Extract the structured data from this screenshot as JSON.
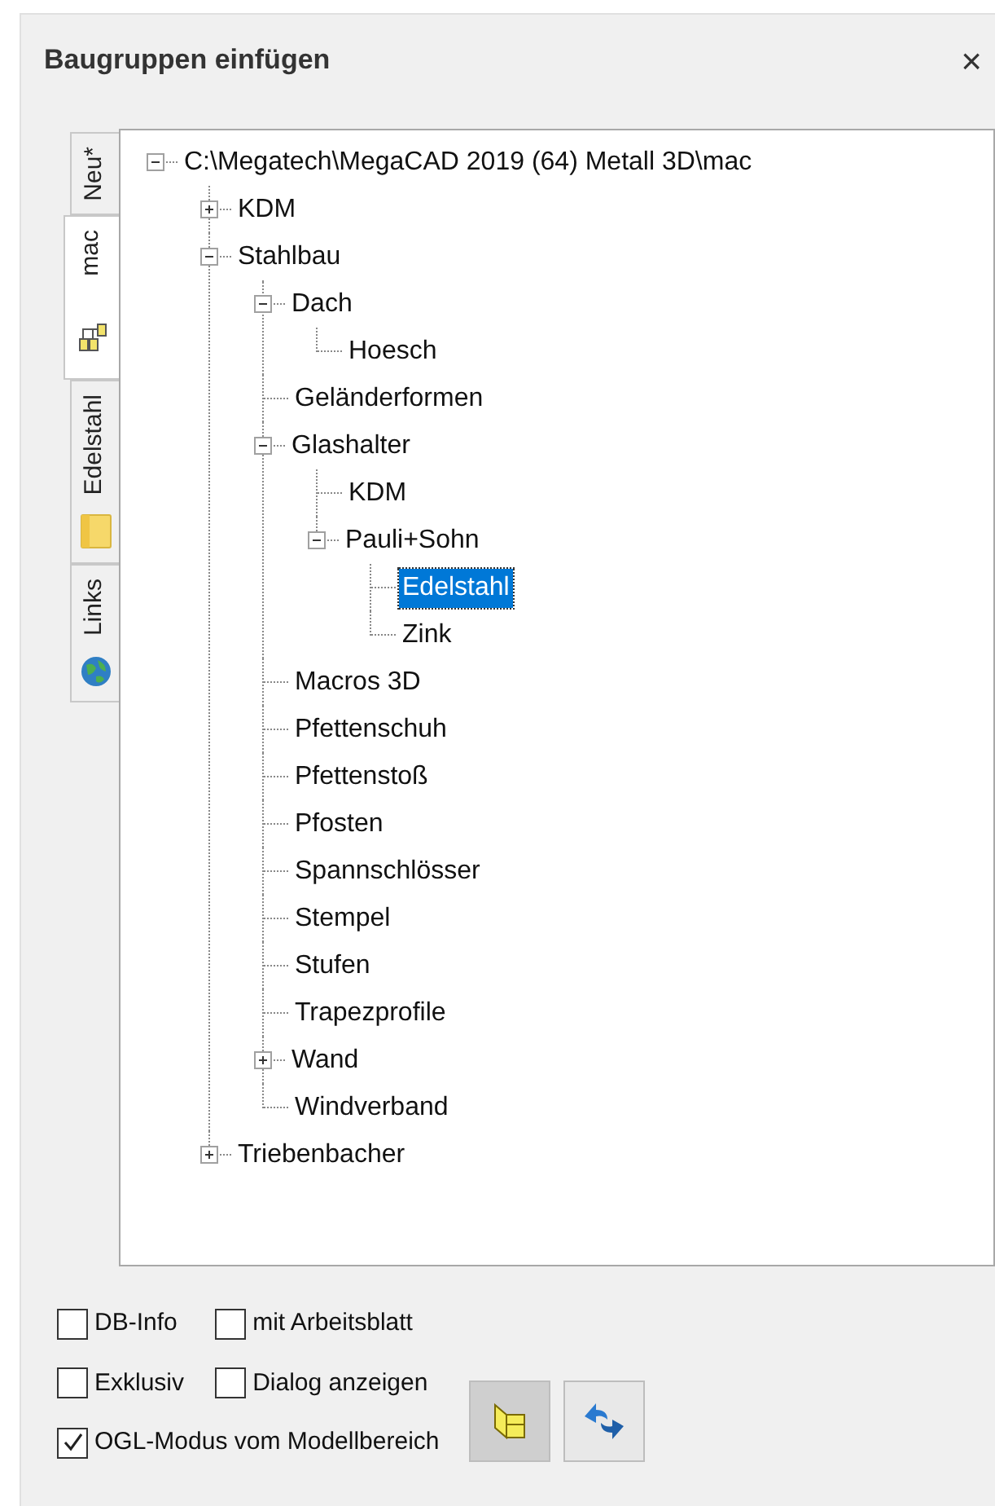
{
  "window": {
    "title": "Baugruppen einfügen",
    "close": "×"
  },
  "side_tabs": [
    {
      "label": "Neu*",
      "kind": "plain",
      "selected": false
    },
    {
      "label": "mac",
      "kind": "tree",
      "selected": true
    },
    {
      "label": "Edelstahl",
      "kind": "folder",
      "selected": false
    },
    {
      "label": "Links",
      "kind": "globe",
      "selected": false
    }
  ],
  "tree": {
    "root": {
      "label": "C:\\Megatech\\MegaCAD 2019 (64) Metall 3D\\mac",
      "kind": "branch",
      "expanded": true,
      "selected": false,
      "children": [
        {
          "label": "KDM",
          "kind": "branch",
          "expanded": false,
          "selected": false
        },
        {
          "label": "Stahlbau",
          "kind": "branch",
          "expanded": true,
          "selected": false,
          "children": [
            {
              "label": "Dach",
              "kind": "branch",
              "expanded": true,
              "selected": false,
              "children": [
                {
                  "label": "Hoesch",
                  "kind": "leaf",
                  "selected": false
                }
              ]
            },
            {
              "label": "Geländerformen",
              "kind": "leaf",
              "selected": false
            },
            {
              "label": "Glashalter",
              "kind": "branch",
              "expanded": true,
              "selected": false,
              "children": [
                {
                  "label": "KDM",
                  "kind": "leaf",
                  "selected": false
                },
                {
                  "label": "Pauli+Sohn",
                  "kind": "branch",
                  "expanded": true,
                  "selected": false,
                  "children": [
                    {
                      "label": "Edelstahl",
                      "kind": "leaf",
                      "selected": true
                    },
                    {
                      "label": "Zink",
                      "kind": "leaf",
                      "selected": false
                    }
                  ]
                }
              ]
            },
            {
              "label": "Macros 3D",
              "kind": "leaf",
              "selected": false
            },
            {
              "label": "Pfettenschuh",
              "kind": "leaf",
              "selected": false
            },
            {
              "label": "Pfettenstoß",
              "kind": "leaf",
              "selected": false
            },
            {
              "label": "Pfosten",
              "kind": "leaf",
              "selected": false
            },
            {
              "label": "Spannschlösser",
              "kind": "leaf",
              "selected": false
            },
            {
              "label": "Stempel",
              "kind": "leaf",
              "selected": false
            },
            {
              "label": "Stufen",
              "kind": "leaf",
              "selected": false
            },
            {
              "label": "Trapezprofile",
              "kind": "leaf",
              "selected": false
            },
            {
              "label": "Wand",
              "kind": "branch",
              "expanded": false,
              "selected": false
            },
            {
              "label": "Windverband",
              "kind": "leaf",
              "selected": false
            }
          ]
        },
        {
          "label": "Triebenbacher",
          "kind": "branch",
          "expanded": false,
          "selected": false
        }
      ]
    }
  },
  "checkboxes": [
    {
      "label": "DB-Info",
      "checked": false
    },
    {
      "label": "mit Arbeitsblatt",
      "checked": false
    },
    {
      "label": "Exklusiv",
      "checked": false
    },
    {
      "label": "Dialog anzeigen",
      "checked": false
    },
    {
      "label": "OGL-Modus vom Modellbereich",
      "checked": true
    }
  ],
  "tool_buttons": [
    {
      "kind": "view",
      "pressed": true
    },
    {
      "kind": "swap",
      "pressed": false
    }
  ]
}
